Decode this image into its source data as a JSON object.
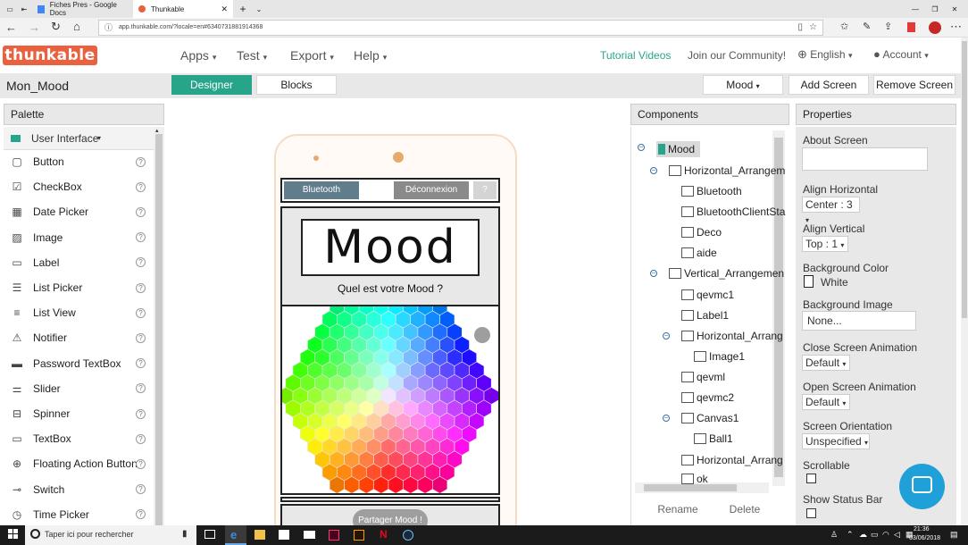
{
  "browser": {
    "tabs": [
      {
        "label": "Fiches Pres - Google Docs"
      },
      {
        "label": "Thunkable"
      }
    ],
    "url": "app.thunkable.com/?locale=en#6340731881914368"
  },
  "app": {
    "logo": "thunkable",
    "menus": [
      "Apps",
      "Test",
      "Export",
      "Help"
    ],
    "links": {
      "tutorial": "Tutorial Videos",
      "community": "Join our Community!"
    },
    "language": "English",
    "account": "Account"
  },
  "toolbar": {
    "project_name": "Mon_Mood",
    "designer": "Designer",
    "blocks": "Blocks",
    "screen": "Mood",
    "add_screen": "Add Screen",
    "remove_screen": "Remove Screen"
  },
  "palette": {
    "title": "Palette",
    "category": "User Interface",
    "items": [
      {
        "label": "Button",
        "icon": "button-icon"
      },
      {
        "label": "CheckBox",
        "icon": "checkbox-icon"
      },
      {
        "label": "Date Picker",
        "icon": "calendar-icon"
      },
      {
        "label": "Image",
        "icon": "image-icon"
      },
      {
        "label": "Label",
        "icon": "label-icon"
      },
      {
        "label": "List Picker",
        "icon": "list-picker-icon"
      },
      {
        "label": "List View",
        "icon": "list-view-icon"
      },
      {
        "label": "Notifier",
        "icon": "warning-icon"
      },
      {
        "label": "Password TextBox",
        "icon": "password-icon"
      },
      {
        "label": "Slider",
        "icon": "slider-icon"
      },
      {
        "label": "Spinner",
        "icon": "spinner-icon"
      },
      {
        "label": "TextBox",
        "icon": "textbox-icon"
      },
      {
        "label": "Floating Action Button",
        "icon": "plus-circle-icon"
      },
      {
        "label": "Switch",
        "icon": "switch-icon"
      },
      {
        "label": "Time Picker",
        "icon": "clock-icon"
      }
    ]
  },
  "phone": {
    "buttons": {
      "bluetooth": "Bluetooth",
      "deconnexion": "Déconnexion",
      "help": "?"
    },
    "title_text": "Mood",
    "question": "Quel est votre Mood ?",
    "share": "Partager Mood !"
  },
  "components": {
    "title": "Components",
    "tree": [
      {
        "label": "Mood",
        "level": 0
      },
      {
        "label": "Horizontal_Arrangem",
        "level": 1
      },
      {
        "label": "Bluetooth",
        "level": 2
      },
      {
        "label": "BluetoothClientSta",
        "level": 2
      },
      {
        "label": "Deco",
        "level": 2
      },
      {
        "label": "aide",
        "level": 2
      },
      {
        "label": "Vertical_Arrangemen",
        "level": 1
      },
      {
        "label": "qevmc1",
        "level": 2
      },
      {
        "label": "Label1",
        "level": 2
      },
      {
        "label": "Horizontal_Arrang",
        "level": 2
      },
      {
        "label": "Image1",
        "level": 3
      },
      {
        "label": "qevml",
        "level": 2
      },
      {
        "label": "qevmc2",
        "level": 2
      },
      {
        "label": "Canvas1",
        "level": 2
      },
      {
        "label": "Ball1",
        "level": 3
      },
      {
        "label": "Horizontal_Arrang",
        "level": 2
      },
      {
        "label": "ok",
        "level": 2
      }
    ],
    "rename": "Rename",
    "delete": "Delete"
  },
  "properties": {
    "title": "Properties",
    "about_screen": "About Screen",
    "align_horizontal": "Align Horizontal",
    "align_horizontal_value": "Center : 3",
    "align_vertical": "Align Vertical",
    "align_vertical_value": "Top : 1",
    "background_color": "Background Color",
    "background_color_value": "White",
    "background_image": "Background Image",
    "background_image_value": "None...",
    "close_anim": "Close Screen Animation",
    "close_anim_value": "Default",
    "open_anim": "Open Screen Animation",
    "open_anim_value": "Default",
    "orientation": "Screen Orientation",
    "orientation_value": "Unspecified",
    "scrollable": "Scrollable",
    "status_bar": "Show Status Bar"
  },
  "taskbar": {
    "search": "Taper ici pour rechercher",
    "time": "21:36",
    "date": "03/06/2018"
  },
  "colors": {
    "brand": "#e9613e",
    "designer_tab": "#27a58a",
    "tutorial_link": "#27a58a",
    "chat_button": "#1fa0d8",
    "phone_button": "#607d8b"
  }
}
